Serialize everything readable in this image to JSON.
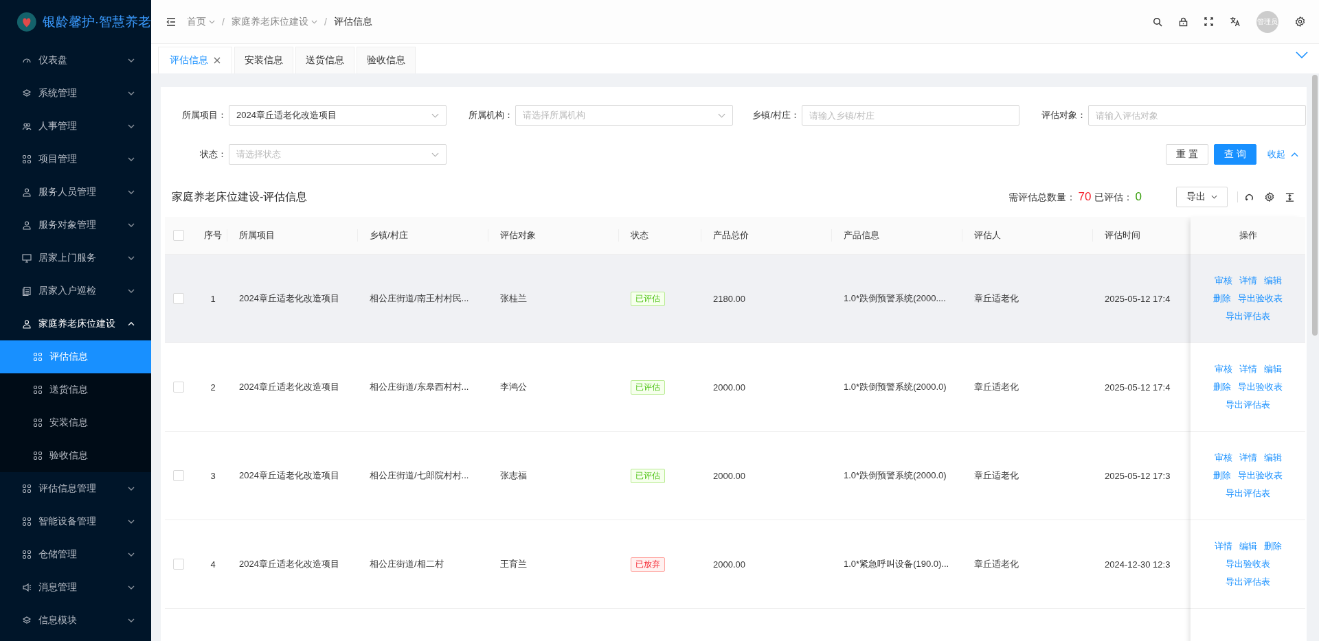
{
  "sidebar": {
    "logo_title": "银龄馨护·智慧养老",
    "items": [
      {
        "label": "仪表盘",
        "expanded": false
      },
      {
        "label": "系统管理",
        "expanded": false
      },
      {
        "label": "人事管理",
        "expanded": false
      },
      {
        "label": "项目管理",
        "expanded": false
      },
      {
        "label": "服务人员管理",
        "expanded": false
      },
      {
        "label": "服务对象管理",
        "expanded": false
      },
      {
        "label": "居家上门服务",
        "expanded": false
      },
      {
        "label": "居家入户巡检",
        "expanded": false
      },
      {
        "label": "家庭养老床位建设",
        "expanded": true,
        "children": [
          {
            "label": "评估信息",
            "selected": true
          },
          {
            "label": "送货信息",
            "selected": false
          },
          {
            "label": "安装信息",
            "selected": false
          },
          {
            "label": "验收信息",
            "selected": false
          }
        ]
      },
      {
        "label": "评估信息管理",
        "expanded": false
      },
      {
        "label": "智能设备管理",
        "expanded": false
      },
      {
        "label": "仓储管理",
        "expanded": false
      },
      {
        "label": "消息管理",
        "expanded": false
      },
      {
        "label": "信息模块",
        "expanded": false
      }
    ]
  },
  "header": {
    "breadcrumb": [
      {
        "label": "首页",
        "dropdown": true
      },
      {
        "separator": "/",
        "label": "家庭养老床位建设",
        "dropdown": true
      },
      {
        "separator": "/",
        "label": "评估信息",
        "dropdown": false
      }
    ],
    "avatar_text": "管理员"
  },
  "tabs": [
    {
      "label": "评估信息",
      "selected": true,
      "closable": true
    },
    {
      "label": "安装信息",
      "selected": false,
      "closable": false
    },
    {
      "label": "送货信息",
      "selected": false,
      "closable": false
    },
    {
      "label": "验收信息",
      "selected": false,
      "closable": false
    }
  ],
  "filters": [
    {
      "label": "所属项目：",
      "kind": "select",
      "value": "2024章丘适老化改造项目"
    },
    {
      "label": "所属机构：",
      "kind": "select",
      "placeholder": "请选择所属机构"
    },
    {
      "label": "乡镇/村庄：",
      "kind": "input",
      "placeholder": "请输入乡镇/村庄"
    },
    {
      "label": "评估对象：",
      "kind": "input",
      "placeholder": "请输入评估对象"
    },
    {
      "label": "状态：",
      "kind": "select",
      "placeholder": "请选择状态"
    }
  ],
  "filter_actions": {
    "reset": "重 置",
    "search": "查 询",
    "collapse": "收起"
  },
  "table": {
    "title": "家庭养老床位建设-评估信息",
    "total_label": "需评估总数量：",
    "total": "70",
    "done_label": "已评估：",
    "done": "0",
    "export": "导出",
    "header_checked": false,
    "columns": [
      "序号",
      "所属项目",
      "乡镇/村庄",
      "评估对象",
      "状态",
      "产品总价",
      "产品信息",
      "评估人",
      "评估时间",
      "操作"
    ],
    "rows": [
      {
        "checked": false,
        "highlighted": true,
        "index": "1",
        "project": "2024章丘适老化改造项目",
        "town": "相公庄街道/南王村村民...",
        "subject": "张桂兰",
        "status": {
          "text": "已评估",
          "kind": "done"
        },
        "price": "2180.00",
        "product": "1.0*跌倒预警系统(2000....",
        "assessor": "章丘适老化",
        "time": "2025-05-12 17:4",
        "actions": [
          "审核",
          "详情",
          "编辑",
          "删除",
          "导出验收表",
          "导出评估表"
        ]
      },
      {
        "checked": false,
        "highlighted": false,
        "index": "2",
        "project": "2024章丘适老化改造项目",
        "town": "相公庄街道/东皋西村村...",
        "subject": "李鸿公",
        "status": {
          "text": "已评估",
          "kind": "done"
        },
        "price": "2000.00",
        "product": "1.0*跌倒预警系统(2000.0)",
        "assessor": "章丘适老化",
        "time": "2025-05-12 17:4",
        "actions": [
          "审核",
          "详情",
          "编辑",
          "删除",
          "导出验收表",
          "导出评估表"
        ]
      },
      {
        "checked": false,
        "highlighted": false,
        "index": "3",
        "project": "2024章丘适老化改造项目",
        "town": "相公庄街道/七郎院村村...",
        "subject": "张志福",
        "status": {
          "text": "已评估",
          "kind": "done"
        },
        "price": "2000.00",
        "product": "1.0*跌倒预警系统(2000.0)",
        "assessor": "章丘适老化",
        "time": "2025-05-12 17:3",
        "actions": [
          "审核",
          "详情",
          "编辑",
          "删除",
          "导出验收表",
          "导出评估表"
        ]
      },
      {
        "checked": false,
        "highlighted": false,
        "index": "4",
        "project": "2024章丘适老化改造项目",
        "town": "相公庄街道/相二村",
        "subject": "王育兰",
        "status": {
          "text": "已放弃",
          "kind": "abandoned"
        },
        "price": "2000.00",
        "product": "1.0*紧急呼叫设备(190.0)...",
        "assessor": "章丘适老化",
        "time": "2024-12-30 12:3",
        "actions": [
          "详情",
          "编辑",
          "删除",
          "导出验收表",
          "导出评估表"
        ]
      }
    ]
  }
}
